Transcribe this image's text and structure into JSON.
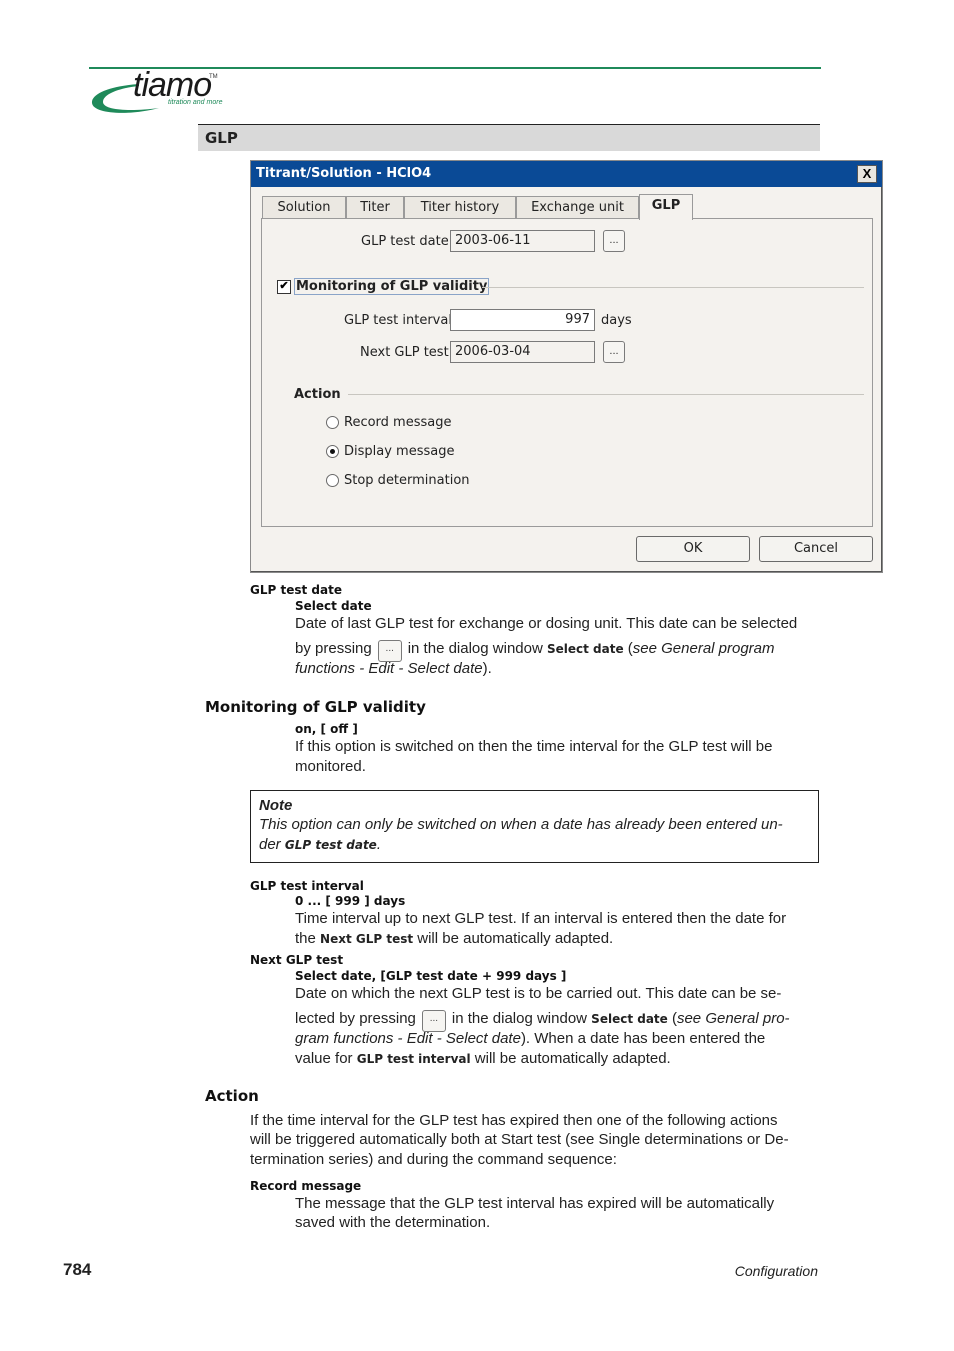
{
  "header": {
    "logo_word": "tiamo",
    "logo_tm": "TM",
    "logo_tagline": "titration and more",
    "section_title": "GLP",
    "brand_color": "#1f8a5a"
  },
  "dialog": {
    "title": "Titrant/Solution - HClO4",
    "close_label": "X",
    "tabs": [
      {
        "label": "Solution",
        "active": false
      },
      {
        "label": "Titer",
        "active": false
      },
      {
        "label": "Titer history",
        "active": false
      },
      {
        "label": "Exchange unit",
        "active": false
      },
      {
        "label": "GLP",
        "active": true
      }
    ],
    "glp_test_date": {
      "label": "GLP test date",
      "value": "2003-06-11",
      "button": "..."
    },
    "monitoring": {
      "label": "Monitoring of GLP validity",
      "checked": true,
      "check_glyph": "✔"
    },
    "glp_test_interval": {
      "label": "GLP test interval",
      "value": "997",
      "unit": "days"
    },
    "next_glp_test": {
      "label": "Next GLP test",
      "value": "2006-03-04",
      "button": "..."
    },
    "action": {
      "label": "Action",
      "options": [
        {
          "label": "Record message",
          "selected": false
        },
        {
          "label": "Display message",
          "selected": true
        },
        {
          "label": "Stop determination",
          "selected": false
        }
      ]
    },
    "ok_label": "OK",
    "cancel_label": "Cancel"
  },
  "doc": {
    "glp_test_date": {
      "term": "GLP test date",
      "value": "Select date",
      "line1": "Date of last GLP test for exchange or dosing unit. This date can be selected",
      "line2_pre": "by pressing",
      "line2_mid": "in the dialog window",
      "line2_bold": "Select date",
      "line2_post_open": "(",
      "line2_italic": "see General program",
      "line3_italic": "functions - Edit - Select date",
      "line3_post": ")."
    },
    "monitoring": {
      "heading": "Monitoring of GLP validity",
      "value": "on, [ off ]",
      "line1": "If this option is switched on then the time interval for the GLP test will be",
      "line2": "monitored."
    },
    "note": {
      "title": "Note",
      "line1": "This option can only be switched on when a date has already been entered un-",
      "line2_pre": "der",
      "line2_bold": "GLP test date",
      "line2_post": "."
    },
    "glp_test_interval": {
      "term": "GLP test interval",
      "value": "0 ... [ 999 ] days",
      "line1": "Time interval up to next GLP test. If an interval is entered then the date for",
      "line2_pre": "the",
      "line2_bold": "Next GLP test",
      "line2_post": "will be automatically adapted."
    },
    "next_glp_test": {
      "term": "Next GLP test",
      "value": "Select date, [GLP test date + 999 days ]",
      "line1": "Date on which the next GLP test is to be carried out. This date can be se-",
      "line2_pre": "lected by pressing",
      "line2_mid": "in the dialog window",
      "line2_bold": "Select date",
      "line2_italic": "see General pro-",
      "line3_italic": "gram functions - Edit - Select date",
      "line3_post": "). When a date has been entered the",
      "line4_pre": "value for",
      "line4_bold": "GLP test interval",
      "line4_post": "will be automatically adapted."
    },
    "action": {
      "heading": "Action",
      "line1": "If the time interval for the GLP test has expired then one of the following actions",
      "line2": "will be triggered automatically both at Start test (see Single determinations or De-",
      "line3": "termination series) and during the command sequence:",
      "record_term": "Record message",
      "record_line1": "The message that the GLP test interval has expired will be automatically",
      "record_line2": "saved with the determination."
    }
  },
  "footer": {
    "page_number": "784",
    "section": "Configuration"
  }
}
